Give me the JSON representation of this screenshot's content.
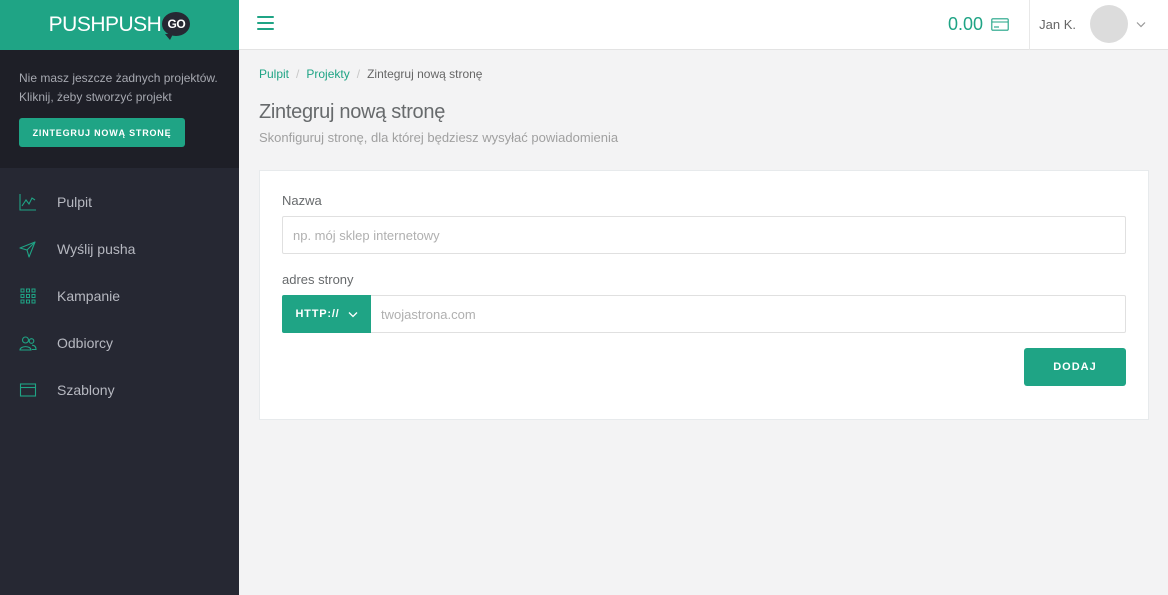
{
  "brand": {
    "name": "PUSHPUSH",
    "badge": "GO",
    "color": "#1fa485"
  },
  "sidebar": {
    "empty_state": {
      "line1": "Nie masz jeszcze żadnych projektów.",
      "line2": "Kliknij, żeby stworzyć projekt",
      "button_label": "ZINTEGRUJ NOWĄ STRONĘ"
    },
    "items": [
      {
        "label": "Pulpit",
        "icon": "chart-line-icon"
      },
      {
        "label": "Wyślij pusha",
        "icon": "send-icon"
      },
      {
        "label": "Kampanie",
        "icon": "grid-icon"
      },
      {
        "label": "Odbiorcy",
        "icon": "users-icon"
      },
      {
        "label": "Szablony",
        "icon": "window-icon"
      }
    ]
  },
  "header": {
    "menu_icon": "hamburger-icon",
    "balance": "0.00",
    "balance_icon": "credit-card-icon",
    "user_name": "Jan K.",
    "user_caret_icon": "chevron-down-icon"
  },
  "breadcrumb": {
    "items": [
      "Pulpit",
      "Projekty"
    ],
    "separator": "/",
    "current": "Zintegruj nową stronę"
  },
  "page": {
    "title": "Zintegruj nową stronę",
    "subtitle": "Skonfiguruj stronę, dla której będziesz wysyłać powiadomienia"
  },
  "form": {
    "name_label": "Nazwa",
    "name_value": "",
    "name_placeholder": "np. mój sklep internetowy",
    "url_label": "adres strony",
    "protocol_selected": "HTTP://",
    "url_value": "",
    "url_placeholder": "twojastrona.com",
    "submit_label": "DODAJ"
  }
}
